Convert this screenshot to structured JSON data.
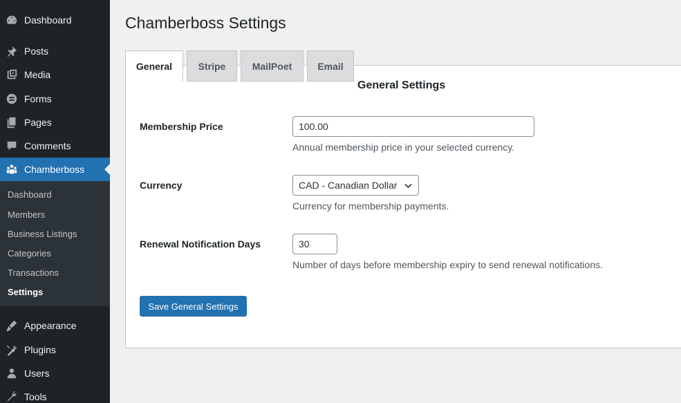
{
  "sidebar": {
    "items": [
      {
        "label": "Dashboard",
        "icon": "dashboard-icon"
      },
      {
        "label": "Posts",
        "icon": "pin-icon"
      },
      {
        "label": "Media",
        "icon": "media-icon"
      },
      {
        "label": "Forms",
        "icon": "forms-icon"
      },
      {
        "label": "Pages",
        "icon": "pages-icon"
      },
      {
        "label": "Comments",
        "icon": "comments-icon"
      },
      {
        "label": "Chamberboss",
        "icon": "groups-icon",
        "current": true
      },
      {
        "label": "Appearance",
        "icon": "appearance-icon"
      },
      {
        "label": "Plugins",
        "icon": "plugins-icon"
      },
      {
        "label": "Users",
        "icon": "users-icon"
      },
      {
        "label": "Tools",
        "icon": "tools-icon"
      }
    ],
    "submenu": [
      "Dashboard",
      "Members",
      "Business Listings",
      "Categories",
      "Transactions",
      "Settings"
    ],
    "submenu_active": "Settings"
  },
  "page": {
    "title": "Chamberboss Settings"
  },
  "tabs": [
    {
      "label": "General",
      "active": true
    },
    {
      "label": "Stripe"
    },
    {
      "label": "MailPoet"
    },
    {
      "label": "Email"
    }
  ],
  "general": {
    "section_title": "General Settings",
    "membership_price": {
      "label": "Membership Price",
      "value": "100.00",
      "description": "Annual membership price in your selected currency."
    },
    "currency": {
      "label": "Currency",
      "value": "CAD - Canadian Dollar",
      "description": "Currency for membership payments."
    },
    "renewal_days": {
      "label": "Renewal Notification Days",
      "value": "30",
      "description": "Number of days before membership expiry to send renewal notifications."
    },
    "save_label": "Save General Settings"
  },
  "colors": {
    "sidebar_bg": "#1d2327",
    "submenu_bg": "#2c3338",
    "accent": "#2271b1",
    "page_bg": "#f0f0f1"
  }
}
